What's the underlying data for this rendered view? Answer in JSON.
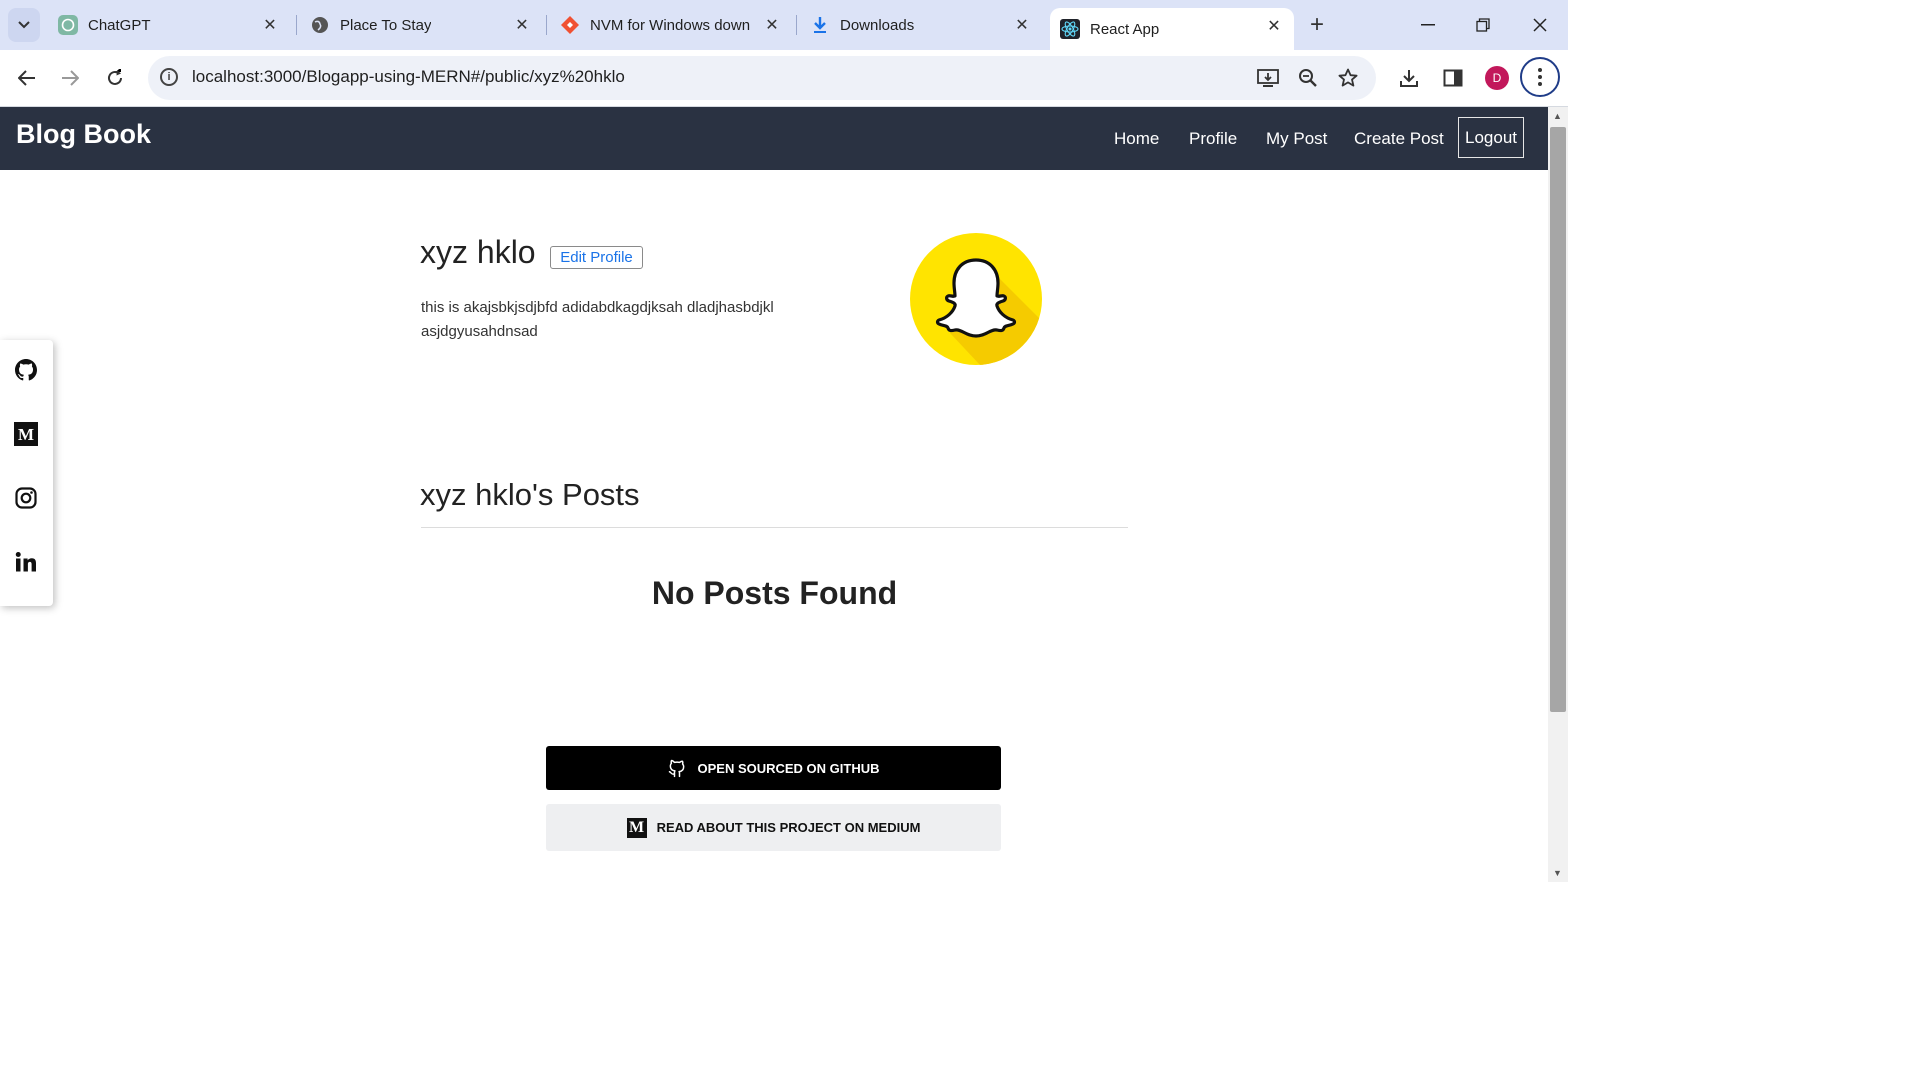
{
  "browser": {
    "tabs": [
      {
        "title": "ChatGPT",
        "icon": "chatgpt-icon"
      },
      {
        "title": "Place To Stay",
        "icon": "globe-icon"
      },
      {
        "title": "NVM for Windows downl",
        "icon": "nvm-icon"
      },
      {
        "title": "Downloads",
        "icon": "download-icon"
      },
      {
        "title": "React App",
        "icon": "react-icon",
        "active": true
      }
    ],
    "url": "localhost:3000/Blogapp-using-MERN#/public/xyz%20hklo",
    "profile_initial": "D"
  },
  "navbar": {
    "brand": "Blog Book",
    "links": [
      "Home",
      "Profile",
      "My Post",
      "Create Post"
    ],
    "logout": "Logout"
  },
  "social": [
    "github-icon",
    "medium-icon",
    "instagram-icon",
    "linkedin-icon"
  ],
  "profile": {
    "name": "xyz hklo",
    "edit_label": "Edit Profile",
    "bio": "this is akajsbkjsdjbfd adidabdkagdjksah dladjhasbdjkl asjdgyusahdnsad",
    "avatar_icon": "snapchat-ghost-icon"
  },
  "posts": {
    "title": "xyz hklo's Posts",
    "empty": "No Posts Found"
  },
  "footer": {
    "github_label": "OPEN SOURCED ON GITHUB",
    "medium_label": "READ ABOUT THIS PROJECT ON MEDIUM"
  },
  "colors": {
    "navbar": "#2a3242",
    "accent": "#1a73e8",
    "snap_yellow": "#ffe400"
  }
}
